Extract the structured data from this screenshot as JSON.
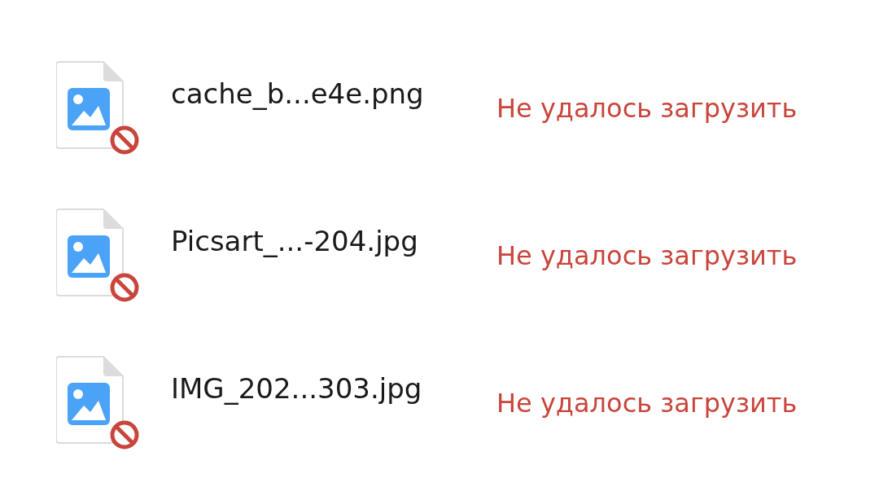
{
  "files": [
    {
      "name": "cache_b...e4e.png",
      "status": "Не удалось загрузить",
      "failed": true
    },
    {
      "name": "Picsart_...-204.jpg",
      "status": "Не удалось загрузить",
      "failed": true
    },
    {
      "name": "IMG_202...303.jpg",
      "status": "Не удалось загрузить",
      "failed": true
    }
  ]
}
